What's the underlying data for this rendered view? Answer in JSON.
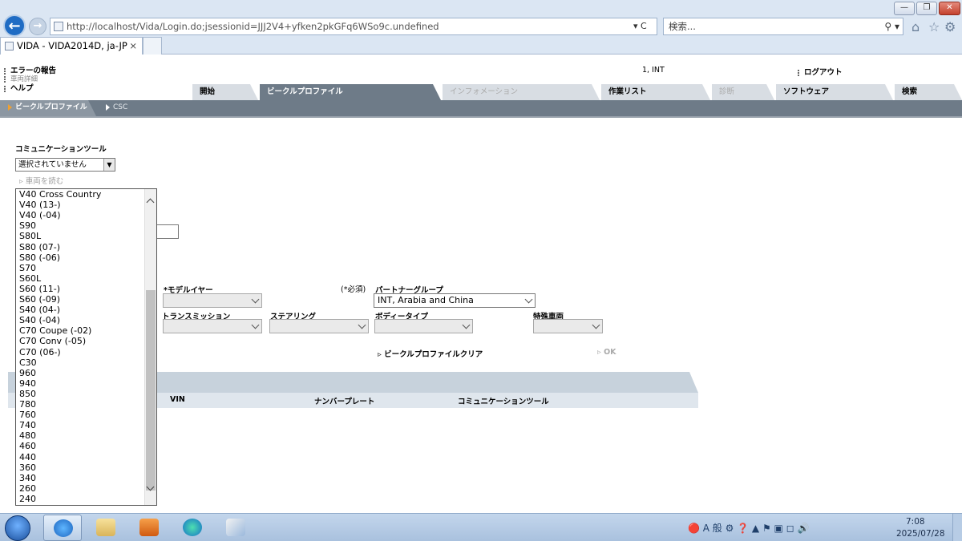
{
  "browser": {
    "address": "http://localhost/Vida/Login.do;jsessionid=JJJ2V4+yfken2pkGFq6WSo9c.undefined",
    "address_tools": "▾ C",
    "search_placeholder": "検索...",
    "tab_title": "VIDA - VIDA2014D, ja-JP",
    "tab_close": "×",
    "window_buttons": {
      "minimize": "—",
      "restore": "❐",
      "close": "✕"
    }
  },
  "header": {
    "links": [
      "エラーの報告",
      "車両詳細",
      "ヘルプ"
    ],
    "user_info": "1, INT",
    "logout": "ログアウト"
  },
  "main_tabs": [
    {
      "label": "開始"
    },
    {
      "label": "ビークルプロファイル"
    },
    {
      "label": "インフォメーション"
    },
    {
      "label": "作業リスト"
    },
    {
      "label": "診断"
    },
    {
      "label": "ソフトウェア"
    },
    {
      "label": "検索"
    }
  ],
  "sub_tabs": [
    "ビークルプロファイル",
    "CSC"
  ],
  "form": {
    "comm_tool_label": "コミュニケーションツール",
    "comm_tool_value": "選択されていません",
    "read_vehicle": "車両を読む",
    "model_year_label": "*モデルイヤー",
    "required_note": "(*必須)",
    "partner_group_label": "パートナーグループ",
    "partner_group_value": "INT, Arabia and China",
    "transmission_label": "トランスミッション",
    "steering_label": "ステアリング",
    "body_type_label": "ボディータイプ",
    "special_vehicle_label": "特殊車両",
    "clear_profile": "ビークルプロファイルクリア",
    "ok": "OK"
  },
  "model_list": [
    "V40 Cross Country",
    "V40 (13-)",
    "V40 (-04)",
    "S90",
    "S80L",
    "S80 (07-)",
    "S80 (-06)",
    "S70",
    "S60L",
    "S60 (11-)",
    "S60 (-09)",
    "S40 (04-)",
    "S40 (-04)",
    "C70 Coupe (-02)",
    "C70 Conv (-05)",
    "C70 (06-)",
    "C30",
    "960",
    "940",
    "850",
    "780",
    "760",
    "740",
    "480",
    "460",
    "440",
    "360",
    "340",
    "260",
    "240"
  ],
  "table": {
    "columns": [
      "VIN",
      "ナンバープレート",
      "コミュニケーションツール"
    ]
  },
  "taskbar": {
    "tray": "🔴 A 般 ⚙ ❓ ▲ ⚑ ▣ ◻ 🔊",
    "time": "7:08",
    "date": "2025/07/28"
  }
}
